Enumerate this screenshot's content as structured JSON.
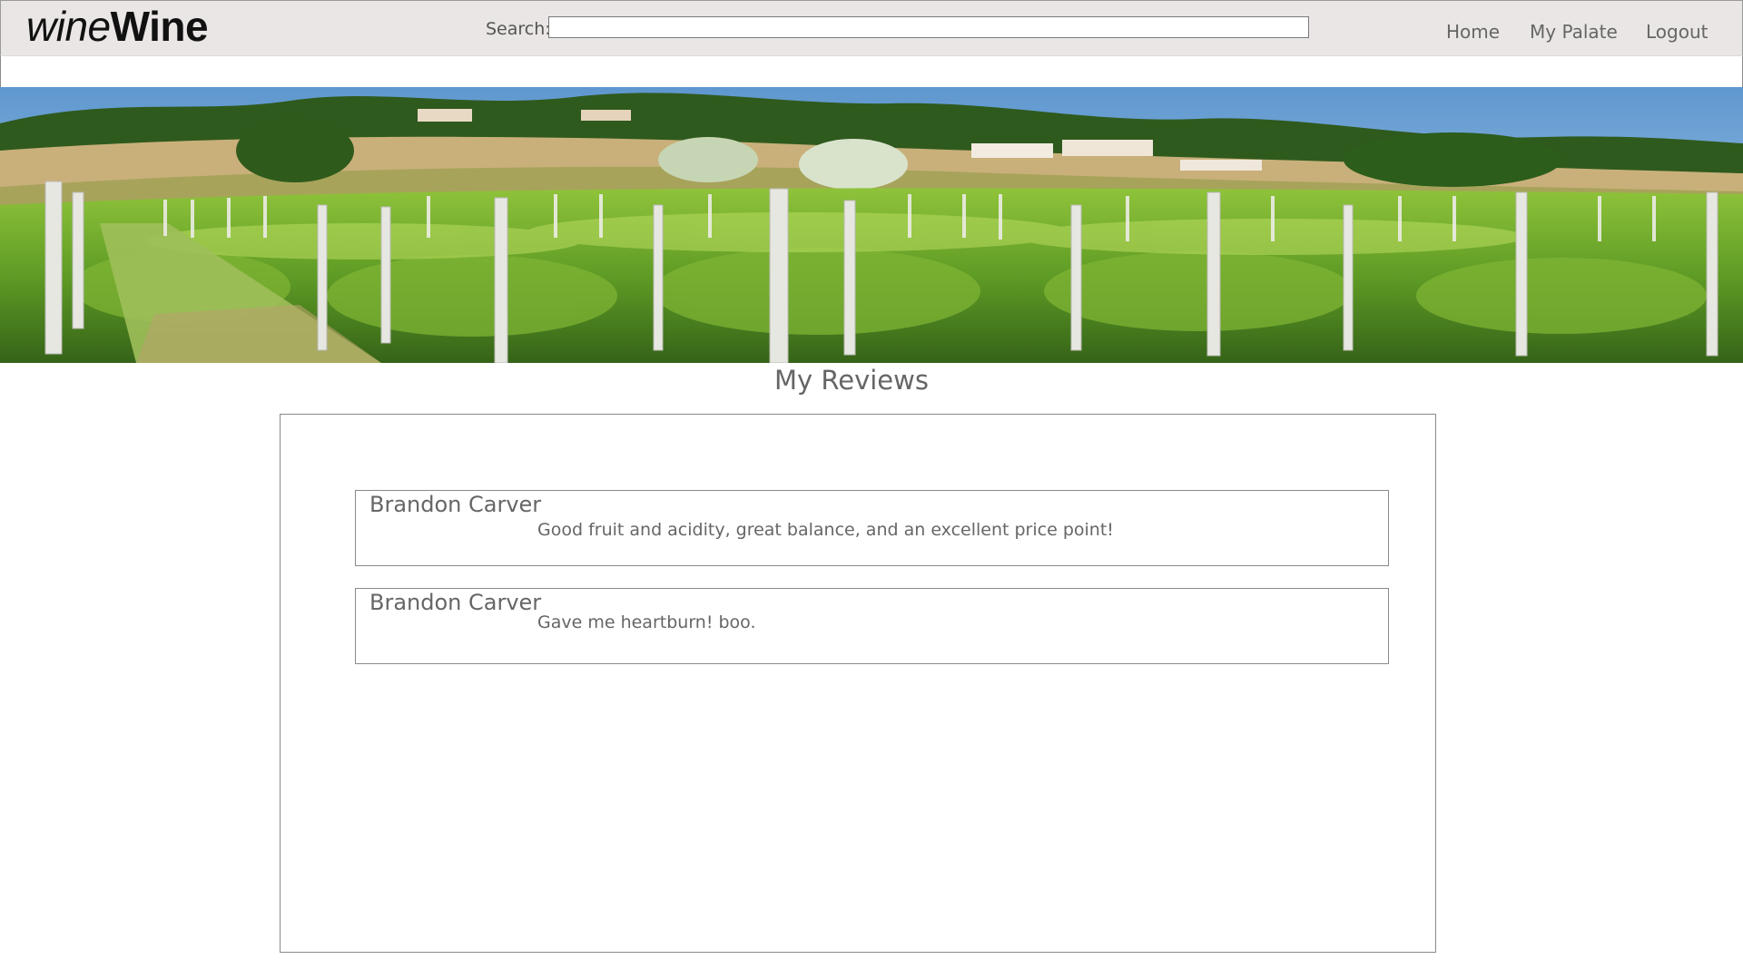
{
  "header": {
    "logo_light": "wine",
    "logo_bold": "Wine",
    "search_label": "Search:",
    "search_value": "",
    "nav": [
      "Home",
      "My Palate",
      "Logout"
    ]
  },
  "banner": {
    "icon": "vineyard-landscape-image"
  },
  "page": {
    "title": "My Reviews"
  },
  "reviews": [
    {
      "author": "Brandon Carver",
      "text": "Good fruit and acidity, great balance, and an excellent price point!"
    },
    {
      "author": "Brandon Carver",
      "text": "Gave me heartburn! boo."
    }
  ]
}
